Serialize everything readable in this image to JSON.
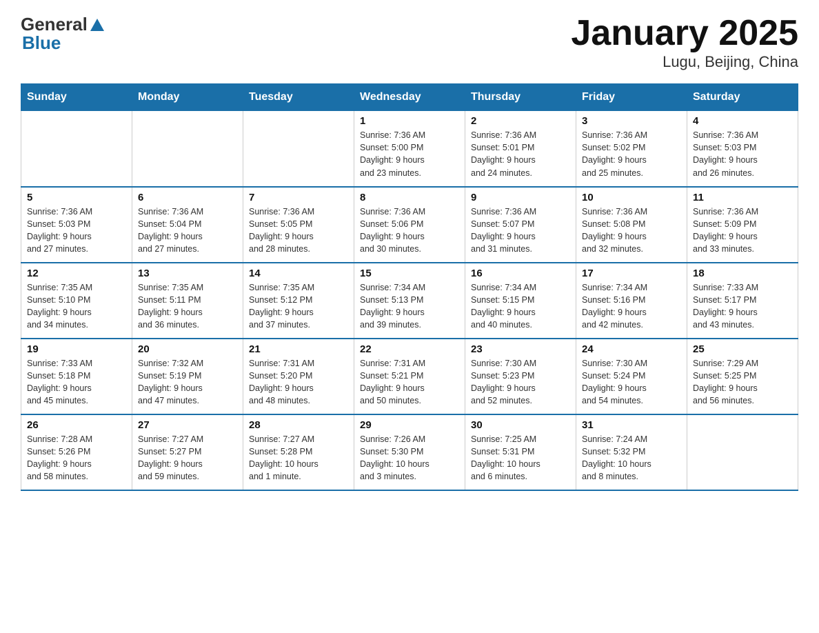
{
  "header": {
    "logo_general": "General",
    "logo_blue": "Blue",
    "title": "January 2025",
    "location": "Lugu, Beijing, China"
  },
  "days_of_week": [
    "Sunday",
    "Monday",
    "Tuesday",
    "Wednesday",
    "Thursday",
    "Friday",
    "Saturday"
  ],
  "weeks": [
    [
      {
        "day": "",
        "info": ""
      },
      {
        "day": "",
        "info": ""
      },
      {
        "day": "",
        "info": ""
      },
      {
        "day": "1",
        "info": "Sunrise: 7:36 AM\nSunset: 5:00 PM\nDaylight: 9 hours\nand 23 minutes."
      },
      {
        "day": "2",
        "info": "Sunrise: 7:36 AM\nSunset: 5:01 PM\nDaylight: 9 hours\nand 24 minutes."
      },
      {
        "day": "3",
        "info": "Sunrise: 7:36 AM\nSunset: 5:02 PM\nDaylight: 9 hours\nand 25 minutes."
      },
      {
        "day": "4",
        "info": "Sunrise: 7:36 AM\nSunset: 5:03 PM\nDaylight: 9 hours\nand 26 minutes."
      }
    ],
    [
      {
        "day": "5",
        "info": "Sunrise: 7:36 AM\nSunset: 5:03 PM\nDaylight: 9 hours\nand 27 minutes."
      },
      {
        "day": "6",
        "info": "Sunrise: 7:36 AM\nSunset: 5:04 PM\nDaylight: 9 hours\nand 27 minutes."
      },
      {
        "day": "7",
        "info": "Sunrise: 7:36 AM\nSunset: 5:05 PM\nDaylight: 9 hours\nand 28 minutes."
      },
      {
        "day": "8",
        "info": "Sunrise: 7:36 AM\nSunset: 5:06 PM\nDaylight: 9 hours\nand 30 minutes."
      },
      {
        "day": "9",
        "info": "Sunrise: 7:36 AM\nSunset: 5:07 PM\nDaylight: 9 hours\nand 31 minutes."
      },
      {
        "day": "10",
        "info": "Sunrise: 7:36 AM\nSunset: 5:08 PM\nDaylight: 9 hours\nand 32 minutes."
      },
      {
        "day": "11",
        "info": "Sunrise: 7:36 AM\nSunset: 5:09 PM\nDaylight: 9 hours\nand 33 minutes."
      }
    ],
    [
      {
        "day": "12",
        "info": "Sunrise: 7:35 AM\nSunset: 5:10 PM\nDaylight: 9 hours\nand 34 minutes."
      },
      {
        "day": "13",
        "info": "Sunrise: 7:35 AM\nSunset: 5:11 PM\nDaylight: 9 hours\nand 36 minutes."
      },
      {
        "day": "14",
        "info": "Sunrise: 7:35 AM\nSunset: 5:12 PM\nDaylight: 9 hours\nand 37 minutes."
      },
      {
        "day": "15",
        "info": "Sunrise: 7:34 AM\nSunset: 5:13 PM\nDaylight: 9 hours\nand 39 minutes."
      },
      {
        "day": "16",
        "info": "Sunrise: 7:34 AM\nSunset: 5:15 PM\nDaylight: 9 hours\nand 40 minutes."
      },
      {
        "day": "17",
        "info": "Sunrise: 7:34 AM\nSunset: 5:16 PM\nDaylight: 9 hours\nand 42 minutes."
      },
      {
        "day": "18",
        "info": "Sunrise: 7:33 AM\nSunset: 5:17 PM\nDaylight: 9 hours\nand 43 minutes."
      }
    ],
    [
      {
        "day": "19",
        "info": "Sunrise: 7:33 AM\nSunset: 5:18 PM\nDaylight: 9 hours\nand 45 minutes."
      },
      {
        "day": "20",
        "info": "Sunrise: 7:32 AM\nSunset: 5:19 PM\nDaylight: 9 hours\nand 47 minutes."
      },
      {
        "day": "21",
        "info": "Sunrise: 7:31 AM\nSunset: 5:20 PM\nDaylight: 9 hours\nand 48 minutes."
      },
      {
        "day": "22",
        "info": "Sunrise: 7:31 AM\nSunset: 5:21 PM\nDaylight: 9 hours\nand 50 minutes."
      },
      {
        "day": "23",
        "info": "Sunrise: 7:30 AM\nSunset: 5:23 PM\nDaylight: 9 hours\nand 52 minutes."
      },
      {
        "day": "24",
        "info": "Sunrise: 7:30 AM\nSunset: 5:24 PM\nDaylight: 9 hours\nand 54 minutes."
      },
      {
        "day": "25",
        "info": "Sunrise: 7:29 AM\nSunset: 5:25 PM\nDaylight: 9 hours\nand 56 minutes."
      }
    ],
    [
      {
        "day": "26",
        "info": "Sunrise: 7:28 AM\nSunset: 5:26 PM\nDaylight: 9 hours\nand 58 minutes."
      },
      {
        "day": "27",
        "info": "Sunrise: 7:27 AM\nSunset: 5:27 PM\nDaylight: 9 hours\nand 59 minutes."
      },
      {
        "day": "28",
        "info": "Sunrise: 7:27 AM\nSunset: 5:28 PM\nDaylight: 10 hours\nand 1 minute."
      },
      {
        "day": "29",
        "info": "Sunrise: 7:26 AM\nSunset: 5:30 PM\nDaylight: 10 hours\nand 3 minutes."
      },
      {
        "day": "30",
        "info": "Sunrise: 7:25 AM\nSunset: 5:31 PM\nDaylight: 10 hours\nand 6 minutes."
      },
      {
        "day": "31",
        "info": "Sunrise: 7:24 AM\nSunset: 5:32 PM\nDaylight: 10 hours\nand 8 minutes."
      },
      {
        "day": "",
        "info": ""
      }
    ]
  ]
}
